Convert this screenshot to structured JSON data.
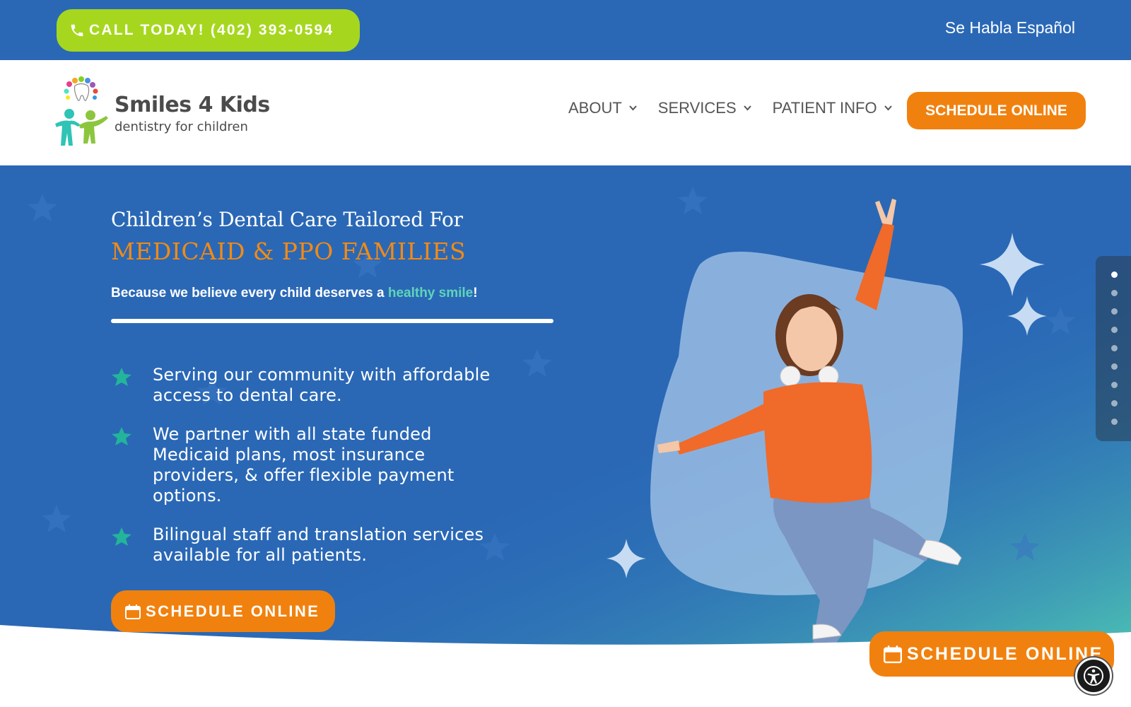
{
  "topbar": {
    "call_label": "CALL TODAY! (402) 393-0594",
    "phone_icon": "phone-icon",
    "language_link": "Se Habla Español",
    "bg_color": "#2a68b6",
    "call_color": "#a6d71e"
  },
  "header": {
    "logo_title": "Smiles 4 Kids",
    "logo_subtitle": "dentistry for children",
    "nav": [
      {
        "label": "ABOUT"
      },
      {
        "label": "SERVICES"
      },
      {
        "label": "PATIENT INFO"
      }
    ],
    "cta_label": "SCHEDULE ONLINE",
    "cta_color": "#f1810e"
  },
  "hero": {
    "title_line1": "Children’s Dental Care Tailored For",
    "title_line2": "MEDICAID & PPO FAMILIES",
    "tagline_prefix": "Because we believe every child deserves a ",
    "tagline_highlight": "healthy smile",
    "tagline_suffix": "!",
    "features": [
      {
        "text": "Serving our community with affordable access to dental care."
      },
      {
        "text": "We partner with all state funded Medicaid plans, most insurance providers, & offer flexible payment options."
      },
      {
        "text": "Bilingual staff and translation services available for all patients."
      }
    ],
    "cta_label": "SCHEDULE ONLINE",
    "title_accent_color": "#f38a14",
    "highlight_color": "#5fd4b7",
    "star_color": "#23b59a"
  },
  "slider": {
    "dot_count": 9,
    "active_index": 0
  },
  "floating": {
    "cta_label": "SCHEDULE ONLINE",
    "accessibility_icon": "accessibility-icon"
  }
}
